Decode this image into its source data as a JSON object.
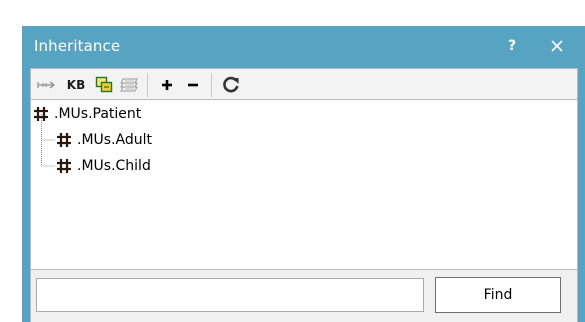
{
  "window": {
    "title": "Inheritance",
    "help_label": "?",
    "accent_color": "#56a4c1"
  },
  "toolbar": {
    "items": [
      {
        "icon": "inherit-arrow-icon",
        "label": ""
      },
      {
        "icon": "kb-text-icon",
        "label": "KB"
      },
      {
        "icon": "copy-frames-icon",
        "label": ""
      },
      {
        "icon": "layers-icon",
        "label": ""
      },
      {
        "icon": "add-plus-icon",
        "label": ""
      },
      {
        "icon": "remove-minus-icon",
        "label": ""
      },
      {
        "icon": "refresh-icon",
        "label": ""
      }
    ]
  },
  "tree": {
    "nodes": [
      {
        "label": ".MUs.Patient",
        "icon": "grid-hash-icon",
        "level": 0
      },
      {
        "label": ".MUs.Adult",
        "icon": "grid-hash-icon",
        "level": 1
      },
      {
        "label": ".MUs.Child",
        "icon": "grid-hash-icon",
        "level": 1
      }
    ]
  },
  "search": {
    "value": "",
    "placeholder": ""
  },
  "find_button": {
    "label": "Find"
  }
}
